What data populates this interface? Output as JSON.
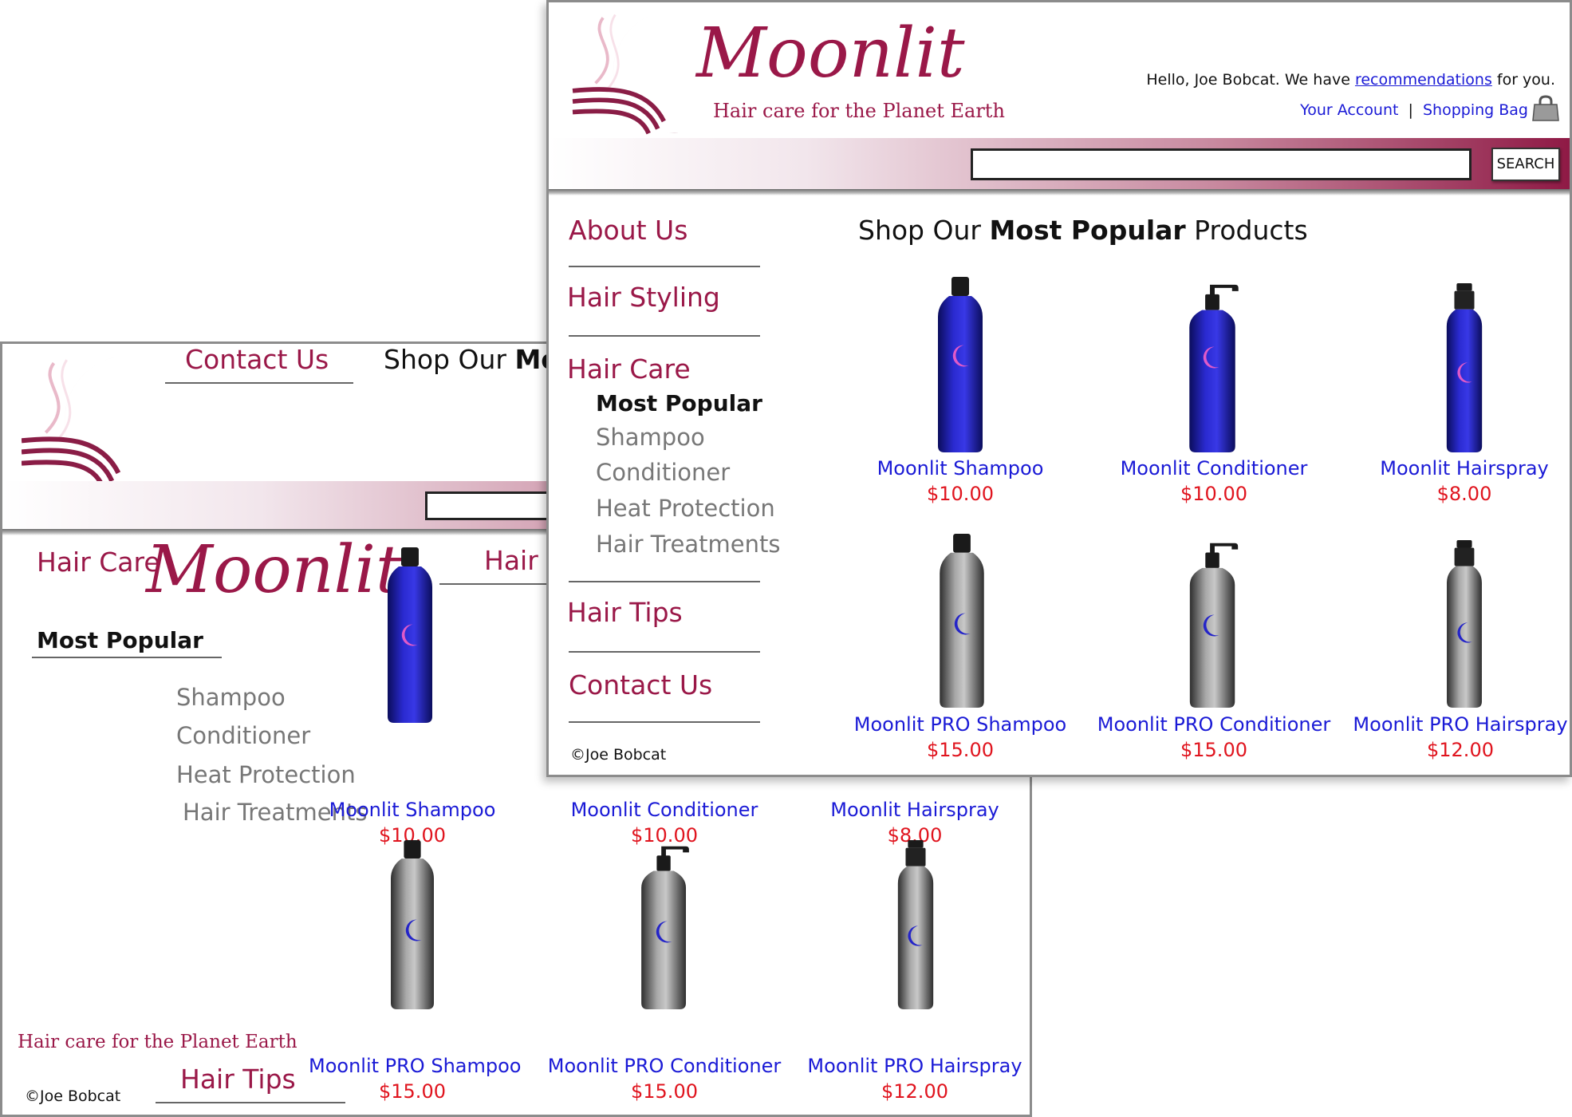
{
  "brand": {
    "name": "Moonlit",
    "tagline": "Hair care for the Planet Earth",
    "colors": {
      "maroon": "#9a1848",
      "link_blue": "#1a1ad6",
      "price_red": "#e0141e"
    }
  },
  "back_window": {
    "nav": {
      "contact": "Contact Us",
      "hair_care": "Hair Care",
      "hair_styling_partial": "Hair S",
      "most_popular": "Most Popular",
      "subs": [
        "Shampoo",
        "Conditioner",
        "Heat Protection",
        "Hair Treatments"
      ],
      "hair_tips": "Hair Tips"
    },
    "heading_prefix": "Shop Our ",
    "heading_bold_partial": "Mos",
    "logo_text": "Moonlit",
    "tagline": "Hair care for the Planet Earth",
    "copyright": "©Joe Bobcat",
    "products": [
      {
        "name": "Moonlit Shampoo",
        "price": "$10.00"
      },
      {
        "name": "Moonlit Conditioner",
        "price": "$10.00"
      },
      {
        "name": "Moonlit Hairspray",
        "price": "$8.00"
      },
      {
        "name": "Moonlit PRO Shampoo",
        "price": "$15.00"
      },
      {
        "name": "Moonlit PRO Conditioner",
        "price": "$15.00"
      },
      {
        "name": "Moonlit PRO Hairspray",
        "price": "$12.00"
      }
    ]
  },
  "front_window": {
    "header": {
      "greeting_prefix": "Hello, Joe Bobcat. We have ",
      "recommendations_link": "recommendations",
      "greeting_suffix": " for you.",
      "your_account": "Your Account",
      "separator": "|",
      "shopping_bag": "Shopping Bag",
      "search_value": "",
      "search_button": "SEARCH"
    },
    "sidebar": {
      "about": "About Us",
      "hair_styling": "Hair Styling",
      "hair_care": "Hair Care",
      "most_popular": "Most Popular",
      "subs": [
        "Shampoo",
        "Conditioner",
        "Heat Protection",
        "Hair Treatments"
      ],
      "hair_tips": "Hair Tips",
      "contact": "Contact Us",
      "copyright": "©Joe Bobcat"
    },
    "heading": {
      "prefix": "Shop Our ",
      "bold": "Most Popular",
      "suffix": " Products"
    },
    "products": [
      {
        "name": "Moonlit Shampoo",
        "price": "$10.00",
        "label": "Shampoo"
      },
      {
        "name": "Moonlit Conditioner",
        "price": "$10.00",
        "label": "Conditioner"
      },
      {
        "name": "Moonlit Hairspray",
        "price": "$8.00",
        "label": "Hairspray"
      },
      {
        "name": "Moonlit PRO Shampoo",
        "price": "$15.00",
        "label": "Shampoo"
      },
      {
        "name": "Moonlit PRO Conditioner",
        "price": "$15.00",
        "label": "Conditioner"
      },
      {
        "name": "Moonlit PRO Hairspray",
        "price": "$12.00",
        "label": "Hairspray"
      }
    ]
  }
}
